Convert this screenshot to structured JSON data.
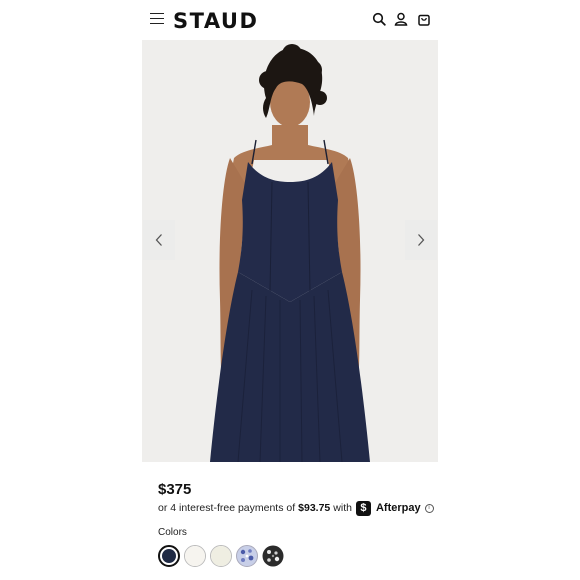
{
  "header": {
    "brand": "STAUD",
    "icons": [
      "menu-icon",
      "search-icon",
      "account-icon",
      "bag-icon"
    ]
  },
  "gallery": {
    "prev_icon": "chevron-left-icon",
    "next_icon": "chevron-right-icon"
  },
  "product": {
    "price": "$375",
    "payment": {
      "text": "or 4 interest-free payments of",
      "amount": "$93.75",
      "with": "with",
      "badge": "$",
      "provider": "Afterpay",
      "info": "i"
    },
    "colors_label": "Colors",
    "swatches": [
      {
        "name": "navy",
        "color": "#1f2a44",
        "selected": true
      },
      {
        "name": "white",
        "color": "#f6f4ef",
        "selected": false
      },
      {
        "name": "ivory",
        "color": "#efeee2",
        "selected": false
      },
      {
        "name": "blue-floral",
        "color": "#b8c2e0",
        "pattern": true,
        "selected": false
      },
      {
        "name": "black-floral",
        "color": "#2b2b2b",
        "pattern": true,
        "selected": false
      }
    ]
  },
  "colors": {
    "dress": "#232b4a",
    "skin": "#b07a55",
    "hair": "#1c1612",
    "background": "#efeeec"
  }
}
